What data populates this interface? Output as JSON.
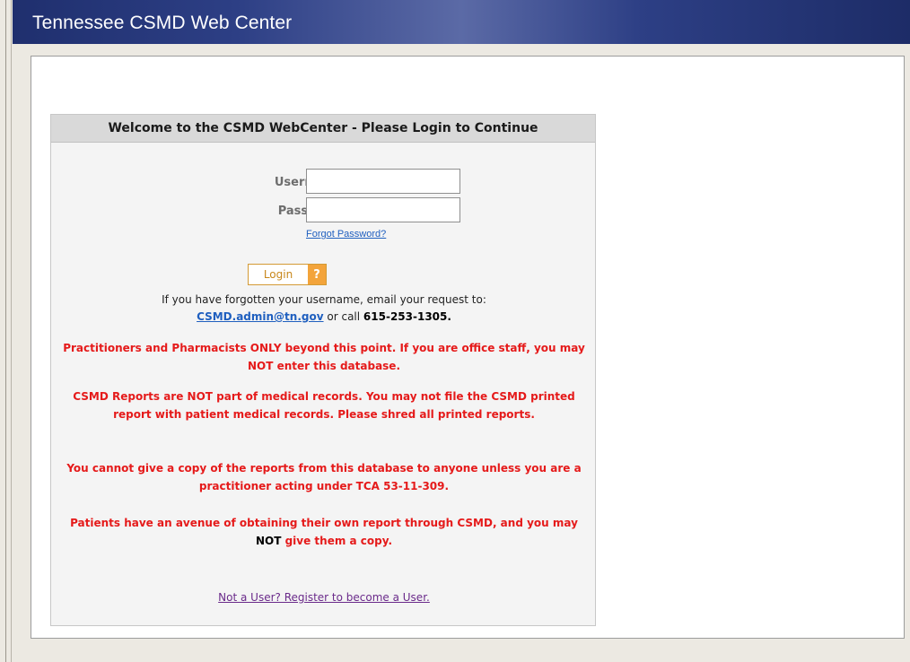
{
  "header": {
    "title": "Tennessee CSMD Web Center"
  },
  "panel": {
    "heading": "Welcome to the CSMD WebCenter - Please Login to Continue",
    "username_label": "Username:",
    "password_label": "Password:",
    "username_value": "",
    "password_value": "",
    "forgot_password": "Forgot Password?",
    "login_label": "Login",
    "login_icon": "?",
    "forgot_username_text": "If you have forgotten your username, email your request to:",
    "admin_email": "CSMD.admin@tn.gov",
    "or_call": "or call",
    "phone": "615-253-1305.",
    "notice_1": "Practitioners and Pharmacists ONLY beyond this point. If you are office staff, you may NOT enter this database.",
    "notice_2": "CSMD Reports are NOT part of medical records. You may not file the CSMD printed report with patient medical records. Please shred all printed reports.",
    "notice_3": "You cannot give a copy of the reports from this database to anyone unless you are a practitioner acting under TCA 53-11-309.",
    "notice_4a": "Patients have an avenue of obtaining their own report through CSMD, and you may",
    "notice_4b": "NOT",
    "notice_4c": "give them a copy.",
    "register_link": "Not a User? Register to become a User."
  },
  "colors": {
    "header_bg": "#2d3f85",
    "warning_red": "#e51a1a",
    "link_blue": "#1f5fbf",
    "visited_purple": "#6a2a8a",
    "login_orange": "#f3a43b"
  },
  "icons": {
    "login": "key-icon"
  }
}
